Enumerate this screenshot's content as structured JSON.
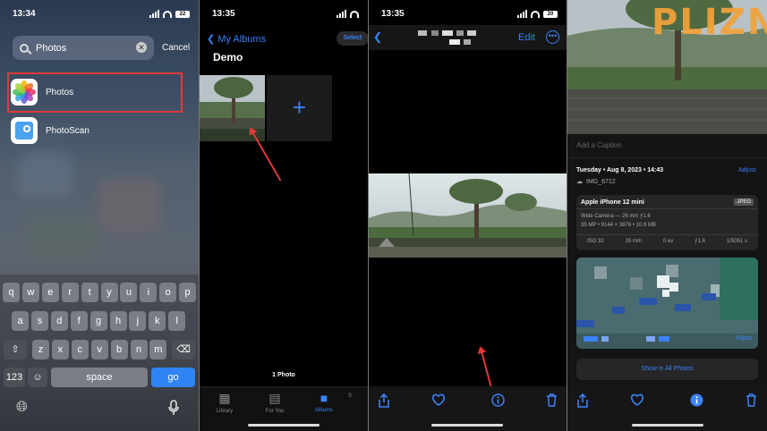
{
  "panel1": {
    "time": "13:34",
    "battery": "22",
    "search_value": "Photos",
    "cancel_label": "Cancel",
    "results": [
      {
        "label": "Photos",
        "icon": "photos-app-icon"
      },
      {
        "label": "PhotoScan",
        "icon": "photoscan-app-icon"
      }
    ],
    "keyboard": {
      "row1": [
        "q",
        "w",
        "e",
        "r",
        "t",
        "y",
        "u",
        "i",
        "o",
        "p"
      ],
      "row2": [
        "a",
        "s",
        "d",
        "f",
        "g",
        "h",
        "j",
        "k",
        "l"
      ],
      "row3": [
        "z",
        "x",
        "c",
        "v",
        "b",
        "n",
        "m"
      ],
      "num_label": "123",
      "space_label": "space",
      "go_label": "go"
    }
  },
  "panel2": {
    "time": "13:35",
    "back_label": "My Albums",
    "select_label": "Select",
    "album_title": "Demo",
    "photo_count": "1 Photo",
    "tabs": [
      {
        "label": "Library"
      },
      {
        "label": "For You"
      },
      {
        "label": "Albums",
        "active": true
      },
      {
        "label": "S"
      }
    ]
  },
  "panel3": {
    "time": "13:35",
    "battery": "20",
    "edit_label": "Edit"
  },
  "panel4": {
    "caption_placeholder": "Add a Caption",
    "date_line": "Tuesday • Aug 8, 2023 • 14:43",
    "adjust_label": "Adjust",
    "file_name": "IMG_6712",
    "device": "Apple iPhone 12 mini",
    "format_badge": "JPEG",
    "lens": "Wide Camera — 26 mm ƒ1.6",
    "specs": "35 MP • 9144 × 3876 • 10.9 MB",
    "exif": [
      "ISO 32",
      "26 mm",
      "0 ev",
      "ƒ1.6",
      "1/5051 s"
    ],
    "map_adjust_label": "Adjust",
    "show_all_label": "Show in All Photos"
  },
  "colors": {
    "accent": "#3b82f6",
    "highlight": "#e03a3a"
  }
}
